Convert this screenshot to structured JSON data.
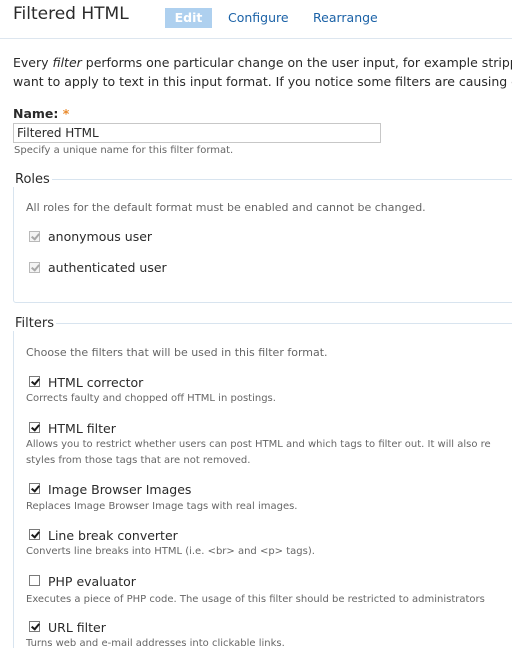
{
  "header": {
    "title": "Filtered HTML",
    "tabs": [
      {
        "label": "Edit",
        "active": true
      },
      {
        "label": "Configure",
        "active": false
      },
      {
        "label": "Rearrange",
        "active": false
      }
    ]
  },
  "intro": {
    "prefix": "Every ",
    "emphasis": "filter",
    "line1_rest": " performs one particular change on the user input, for example stripping",
    "line2": "want to apply to text in this input format. If you notice some filters are causing con"
  },
  "name_field": {
    "label": "Name:",
    "required_marker": "*",
    "value": "Filtered HTML",
    "description": "Specify a unique name for this filter format."
  },
  "roles": {
    "legend": "Roles",
    "description": "All roles for the default format must be enabled and cannot be changed.",
    "items": [
      {
        "label": "anonymous user",
        "checked": true,
        "disabled": true
      },
      {
        "label": "authenticated user",
        "checked": true,
        "disabled": true
      }
    ]
  },
  "filters": {
    "legend": "Filters",
    "description": "Choose the filters that will be used in this filter format.",
    "items": [
      {
        "label": "HTML corrector",
        "checked": true,
        "description": "Corrects faulty and chopped off HTML in postings."
      },
      {
        "label": "HTML filter",
        "checked": true,
        "description": "Allows you to restrict whether users can post HTML and which tags to filter out. It will also re",
        "description_line2": "styles from those tags that are not removed."
      },
      {
        "label": "Image Browser Images",
        "checked": true,
        "description": "Replaces Image Browser Image tags with real images."
      },
      {
        "label": "Line break converter",
        "checked": true,
        "description": "Converts line breaks into HTML (i.e. <br> and <p> tags)."
      },
      {
        "label": "PHP evaluator",
        "checked": false,
        "description": "Executes a piece of PHP code. The usage of this filter should be restricted to administrators"
      },
      {
        "label": "URL filter",
        "checked": true,
        "description": "Turns web and e-mail addresses into clickable links."
      }
    ]
  }
}
